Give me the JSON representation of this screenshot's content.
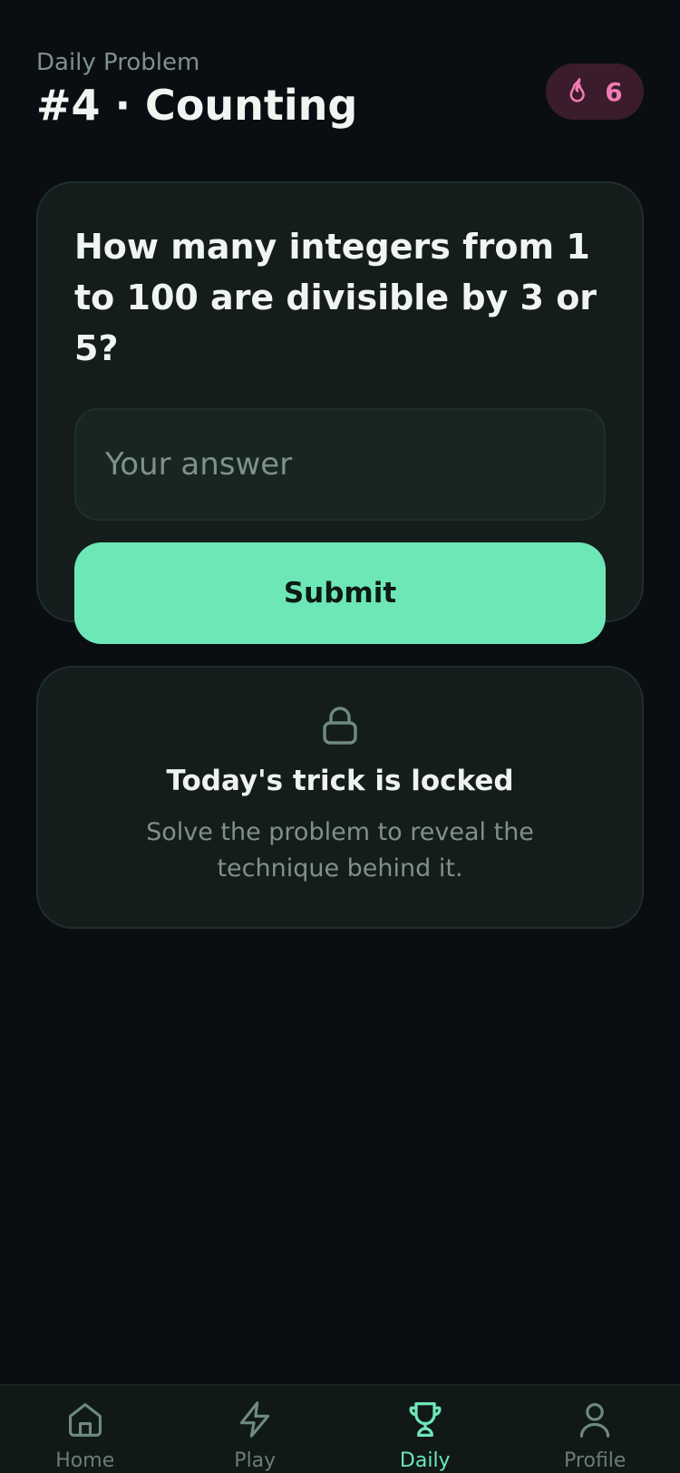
{
  "header": {
    "subtitle": "Daily Problem",
    "title": "#4 · Counting"
  },
  "streak": {
    "icon": "flame-icon",
    "count": "6",
    "color": "#f27bb3"
  },
  "problem": {
    "question": "How many integers from 1 to 100 are divisible by 3 or 5?",
    "answer_value": "",
    "answer_placeholder": "Your answer",
    "submit_label": "Submit"
  },
  "trick": {
    "icon": "lock-icon",
    "title": "Today's trick is locked",
    "description": "Solve the problem to reveal the technique behind it."
  },
  "nav": {
    "active": "Daily",
    "accent_color": "#6ee7b7",
    "items": [
      {
        "label": "Home",
        "icon": "home-icon"
      },
      {
        "label": "Play",
        "icon": "lightning-icon"
      },
      {
        "label": "Daily",
        "icon": "trophy-icon"
      },
      {
        "label": "Profile",
        "icon": "user-icon"
      }
    ]
  }
}
